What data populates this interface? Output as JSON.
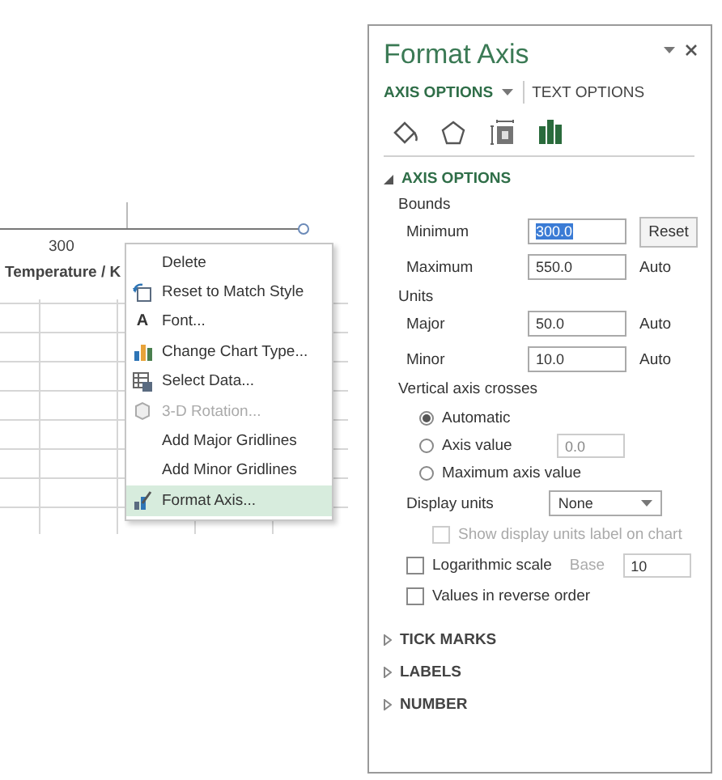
{
  "chart": {
    "axis_label": "300",
    "axis_title": "Temperature / K"
  },
  "context_menu": [
    {
      "label": "Delete",
      "kind": "none",
      "disabled": false,
      "selected": false
    },
    {
      "label": "Reset to Match Style",
      "kind": "reset",
      "disabled": false,
      "selected": false
    },
    {
      "label": "Font...",
      "kind": "font",
      "disabled": false,
      "selected": false,
      "icon_text": "A"
    },
    {
      "label": "Change Chart Type...",
      "kind": "chart",
      "disabled": false,
      "selected": false
    },
    {
      "label": "Select Data...",
      "kind": "data",
      "disabled": false,
      "selected": false
    },
    {
      "label": "3-D Rotation...",
      "kind": "cube",
      "disabled": true,
      "selected": false
    },
    {
      "label": "Add Major Gridlines",
      "kind": "none",
      "disabled": false,
      "selected": false
    },
    {
      "label": "Add Minor Gridlines",
      "kind": "none",
      "disabled": false,
      "selected": false
    },
    {
      "label": "Format Axis...",
      "kind": "format",
      "disabled": false,
      "selected": true
    }
  ],
  "pane": {
    "title": "Format Axis",
    "tabs": [
      {
        "label": "AXIS OPTIONS",
        "selected": true
      },
      {
        "label": "TEXT OPTIONS",
        "selected": false
      }
    ],
    "icon_tabs": [
      {
        "kind": "fill",
        "selected": false
      },
      {
        "kind": "effects",
        "selected": false
      },
      {
        "kind": "size",
        "selected": false
      },
      {
        "kind": "options",
        "selected": true
      }
    ],
    "section": {
      "title": "AXIS OPTIONS",
      "expanded": true
    },
    "bounds": {
      "label": "Bounds",
      "rows": [
        {
          "label": "Minimum",
          "value": "300.0",
          "action": "Reset",
          "kind": "button"
        },
        {
          "label": "Maximum",
          "value": "550.0",
          "action": "Auto",
          "kind": "text"
        }
      ]
    },
    "units": {
      "label": "Units",
      "rows": [
        {
          "label": "Major",
          "value": "50.0",
          "action": "Auto",
          "kind": "text"
        },
        {
          "label": "Minor",
          "value": "10.0",
          "action": "Auto",
          "kind": "text"
        }
      ]
    },
    "crosses": {
      "label": "Vertical axis crosses",
      "options": [
        {
          "label": "Automatic",
          "selected": true
        },
        {
          "label": "Axis value",
          "selected": false,
          "value": "0.0"
        },
        {
          "label": "Maximum axis value",
          "selected": false
        }
      ]
    },
    "display_units": {
      "label": "Display units",
      "value": "None"
    },
    "checks": [
      {
        "label": "Show display units label on chart",
        "checked": false,
        "disabled": true,
        "kind": "indented"
      },
      {
        "label": "Logarithmic scale",
        "checked": false,
        "disabled": false,
        "kind": "base",
        "base_label": "Base",
        "base_value": "10"
      },
      {
        "label": "Values in reverse order",
        "checked": false,
        "disabled": false,
        "kind": "plain"
      }
    ],
    "collapsed_sections": [
      {
        "title": "TICK MARKS",
        "expanded": false
      },
      {
        "title": "LABELS",
        "expanded": false
      },
      {
        "title": "NUMBER",
        "expanded": false
      }
    ]
  }
}
